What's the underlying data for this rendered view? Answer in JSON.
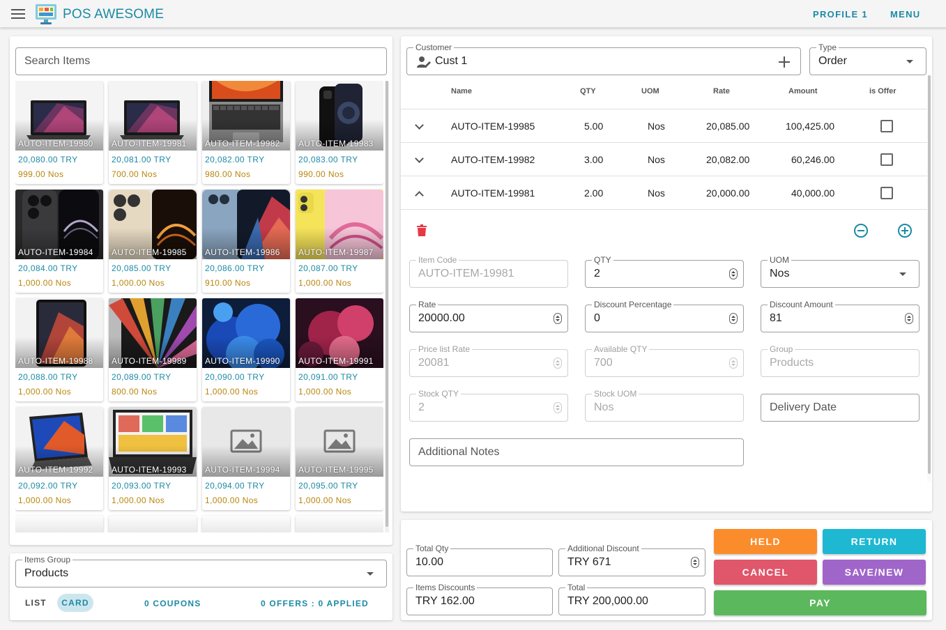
{
  "header": {
    "title": "POS AWESOME",
    "profile_label": "PROFILE 1",
    "menu_label": "MENU"
  },
  "search": {
    "placeholder": "Search Items"
  },
  "items": [
    {
      "name": "AUTO-ITEM-19980",
      "price": "20,080.00 TRY",
      "qty": "999.00 Nos",
      "img": "laptop"
    },
    {
      "name": "AUTO-ITEM-19981",
      "price": "20,081.00 TRY",
      "qty": "700.00 Nos",
      "img": "laptop"
    },
    {
      "name": "AUTO-ITEM-19982",
      "price": "20,082.00 TRY",
      "qty": "980.00 Nos",
      "img": "laptop-open"
    },
    {
      "name": "AUTO-ITEM-19983",
      "price": "20,083.00 TRY",
      "qty": "990.00 Nos",
      "img": "phone-dark"
    },
    {
      "name": "AUTO-ITEM-19984",
      "price": "20,084.00 TRY",
      "qty": "1,000.00 Nos",
      "img": "phone-black"
    },
    {
      "name": "AUTO-ITEM-19985",
      "price": "20,085.00 TRY",
      "qty": "1,000.00 Nos",
      "img": "phone-gold"
    },
    {
      "name": "AUTO-ITEM-19986",
      "price": "20,086.00 TRY",
      "qty": "910.00 Nos",
      "img": "phone-blue"
    },
    {
      "name": "AUTO-ITEM-19987",
      "price": "20,087.00 TRY",
      "qty": "1,000.00 Nos",
      "img": "phone-yellow"
    },
    {
      "name": "AUTO-ITEM-19988",
      "price": "20,088.00 TRY",
      "qty": "1,000.00 Nos",
      "img": "tablet-dark"
    },
    {
      "name": "AUTO-ITEM-19989",
      "price": "20,089.00 TRY",
      "qty": "800.00 Nos",
      "img": "tablet-rays"
    },
    {
      "name": "AUTO-ITEM-19990",
      "price": "20,090.00 TRY",
      "qty": "1,000.00 Nos",
      "img": "tablet-blue"
    },
    {
      "name": "AUTO-ITEM-19991",
      "price": "20,091.00 TRY",
      "qty": "1,000.00 Nos",
      "img": "tablet-pink"
    },
    {
      "name": "AUTO-ITEM-19992",
      "price": "20,092.00 TRY",
      "qty": "1,000.00 Nos",
      "img": "tablet-keyboard"
    },
    {
      "name": "AUTO-ITEM-19993",
      "price": "20,093.00 TRY",
      "qty": "1,000.00 Nos",
      "img": "tablet-case"
    },
    {
      "name": "AUTO-ITEM-19994",
      "price": "20,094.00 TRY",
      "qty": "1,000.00 Nos",
      "img": "placeholder"
    },
    {
      "name": "AUTO-ITEM-19995",
      "price": "20,095.00 TRY",
      "qty": "1,000.00 Nos",
      "img": "placeholder"
    }
  ],
  "items_group": {
    "label": "Items Group",
    "value": "Products"
  },
  "footer": {
    "list_label": "LIST",
    "card_label": "CARD",
    "coupons_label": "0 COUPONS",
    "offers_label": "0 OFFERS : 0 APPLIED"
  },
  "customer": {
    "label": "Customer",
    "value": "Cust 1"
  },
  "type": {
    "label": "Type",
    "value": "Order"
  },
  "table": {
    "headers": {
      "name": "Name",
      "qty": "QTY",
      "uom": "UOM",
      "rate": "Rate",
      "amount": "Amount",
      "offer": "is Offer"
    },
    "rows": [
      {
        "name": "AUTO-ITEM-19985",
        "qty": "5.00",
        "uom": "Nos",
        "rate": "20,085.00",
        "amount": "100,425.00"
      },
      {
        "name": "AUTO-ITEM-19982",
        "qty": "3.00",
        "uom": "Nos",
        "rate": "20,082.00",
        "amount": "60,246.00"
      },
      {
        "name": "AUTO-ITEM-19981",
        "qty": "2.00",
        "uom": "Nos",
        "rate": "20,000.00",
        "amount": "40,000.00"
      }
    ]
  },
  "detail": {
    "item_code": {
      "label": "Item Code",
      "value": "AUTO-ITEM-19981"
    },
    "qty": {
      "label": "QTY",
      "value": "2"
    },
    "uom": {
      "label": "UOM",
      "value": "Nos"
    },
    "rate": {
      "label": "Rate",
      "value": "20000.00"
    },
    "discount_percentage": {
      "label": "Discount Percentage",
      "value": "0"
    },
    "discount_amount": {
      "label": "Discount Amount",
      "value": "81"
    },
    "price_list_rate": {
      "label": "Price list Rate",
      "value": "20081"
    },
    "available_qty": {
      "label": "Available QTY",
      "value": "700"
    },
    "group": {
      "label": "Group",
      "value": "Products"
    },
    "stock_qty": {
      "label": "Stock QTY",
      "value": "2"
    },
    "stock_uom": {
      "label": "Stock UOM",
      "value": "Nos"
    },
    "delivery_date": {
      "placeholder": "Delivery Date"
    },
    "additional_notes": {
      "placeholder": "Additional Notes"
    }
  },
  "totals": {
    "total_qty": {
      "label": "Total Qty",
      "value": "10.00"
    },
    "additional_discount": {
      "label": "Additional Discount",
      "value": "TRY 671"
    },
    "items_discounts": {
      "label": "Items Discounts",
      "value": "TRY 162.00"
    },
    "total": {
      "label": "Total",
      "value": "TRY 200,000.00"
    }
  },
  "actions": {
    "held": "HELD",
    "return": "RETURN",
    "cancel": "CANCEL",
    "save_new": "SAVE/NEW",
    "pay": "PAY"
  },
  "colors": {
    "accent": "#1b8aa5",
    "held": "#fb8c2c",
    "return": "#1fb8d3",
    "cancel": "#e0566a",
    "save_new": "#a065c9",
    "pay": "#5cb85c",
    "delete": "#e53945"
  }
}
